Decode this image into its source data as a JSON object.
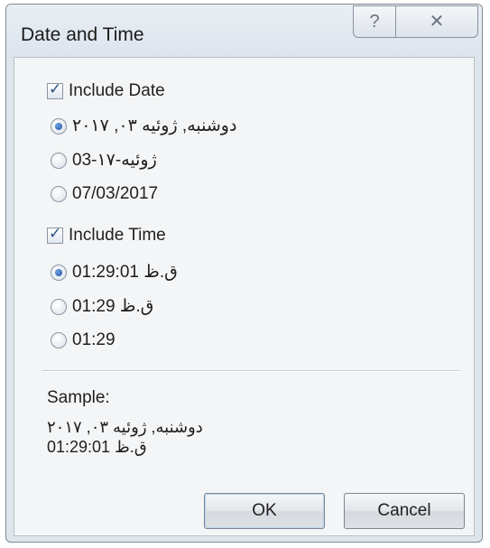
{
  "window": {
    "title": "Date and Time",
    "help_glyph": "?",
    "close_glyph": "✕"
  },
  "date_section": {
    "include_label": "Include Date",
    "include_checked": true,
    "options": [
      {
        "label": "دوشنبه, ژوئیه ۰۳, ۲۰۱۷",
        "selected": true
      },
      {
        "label": "ژوئیه-۱۷-03",
        "selected": false
      },
      {
        "label": "07/03/2017",
        "selected": false
      }
    ]
  },
  "time_section": {
    "include_label": "Include Time",
    "include_checked": true,
    "options": [
      {
        "label": "ق.ظ 01:29:01",
        "selected": true
      },
      {
        "label": "ق.ظ 01:29",
        "selected": false
      },
      {
        "label": "01:29",
        "selected": false
      }
    ]
  },
  "sample": {
    "label": "Sample:",
    "line1": "دوشنبه, ژوئیه ۰۳, ۲۰۱۷",
    "line2": "ق.ظ 01:29:01"
  },
  "buttons": {
    "ok_label": "OK",
    "cancel_label": "Cancel"
  },
  "colors": {
    "frame": "#dfe5ec",
    "client": "#f4f5f6",
    "accent": "#1f4f9c"
  }
}
